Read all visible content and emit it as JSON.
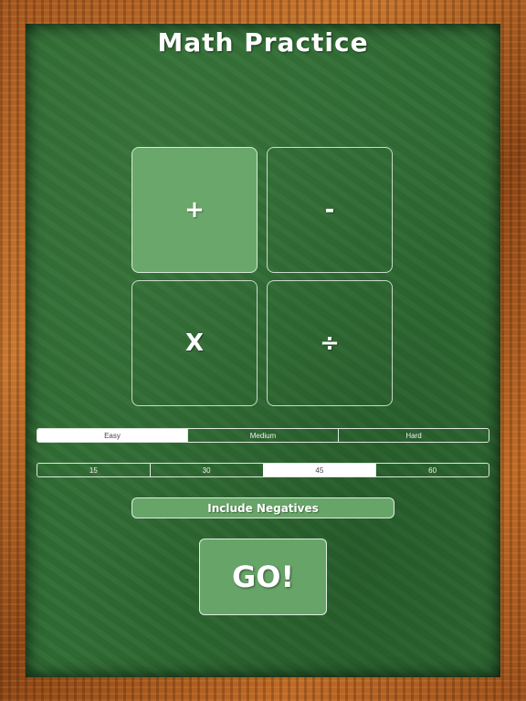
{
  "app": {
    "title": "Math Practice"
  },
  "operations": [
    {
      "symbol": "+",
      "selected": true
    },
    {
      "symbol": "-",
      "selected": false
    },
    {
      "symbol": "X",
      "selected": false
    },
    {
      "symbol": "÷",
      "selected": false
    }
  ],
  "difficulty": {
    "options": [
      "Easy",
      "Medium",
      "Hard"
    ],
    "selected": "Easy"
  },
  "time": {
    "options": [
      "15",
      "30",
      "45",
      "60"
    ],
    "selected": "45"
  },
  "negatives_toggle": {
    "label": "Include Negatives"
  },
  "go_button": {
    "label": "GO!"
  },
  "colors": {
    "board": "#2f6b33",
    "selected_tile": "#6aa76a",
    "button_fill": "#67a468",
    "frame_wood": "#a4561f"
  }
}
